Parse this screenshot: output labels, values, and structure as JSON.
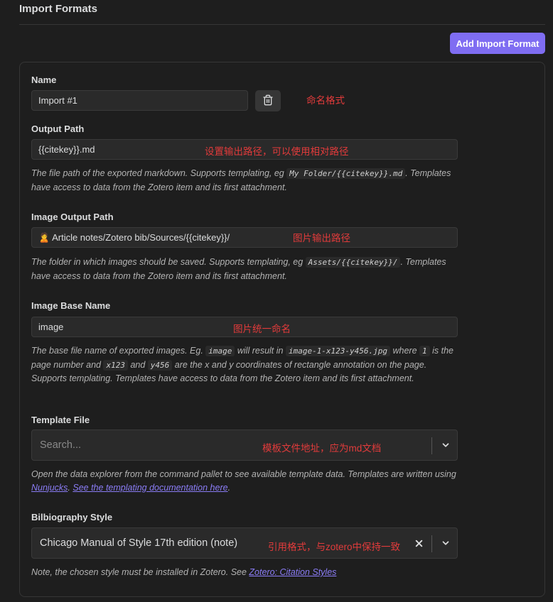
{
  "section": {
    "title": "Import Formats"
  },
  "actions": {
    "add_import_format": "Add Import Format"
  },
  "form": {
    "name": {
      "label": "Name",
      "value": "Import #1",
      "note": "命名格式"
    },
    "output_path": {
      "label": "Output Path",
      "value": "{{citekey}}.md",
      "note": "设置输出路径，可以使用相对路径",
      "desc_1": "The file path of the exported markdown. Supports templating, eg ",
      "desc_code": "My Folder/{{citekey}}.md",
      "desc_2": ". Templates have access to data from the Zotero item and its first attachment."
    },
    "image_output_path": {
      "label": "Image Output Path",
      "value": "🙎 Article notes/Zotero bib/Sources/{{citekey}}/",
      "note": "图片输出路径",
      "desc_1": "The folder in which images should be saved. Supports templating, eg ",
      "desc_code": "Assets/{{citekey}}/",
      "desc_2": ". Templates have access to data from the Zotero item and its first attachment."
    },
    "image_base_name": {
      "label": "Image Base Name",
      "value": "image",
      "note": "图片统一命名",
      "desc_1": "The base file name of exported images. Eg. ",
      "code_image": "image",
      "desc_2": " will result in ",
      "code_example": "image-1-x123-y456.jpg",
      "desc_3": " where ",
      "code_1": "1",
      "desc_4": " is the page number and ",
      "code_x": "x123",
      "desc_5": " and ",
      "code_y": "y456",
      "desc_6": " are the x and y coordinates of rectangle annotation on the page. Supports templating. Templates have access to data from the Zotero item and its first attachment."
    },
    "template_file": {
      "label": "Template File",
      "placeholder": "Search...",
      "note": "模板文件地址，应为md文档",
      "desc_1": "Open the data explorer from the command pallet to see available template data. Templates are written using ",
      "link_nunjucks": "Nunjucks",
      "desc_2": ". ",
      "link_docs": "See the templating documentation here",
      "desc_3": "."
    },
    "bibliography_style": {
      "label": "Bilbiography Style",
      "value": "Chicago Manual of Style 17th edition (note)",
      "note": "引用格式，与zotero中保持一致",
      "desc_1": "Note, the chosen style must be installed in Zotero. See ",
      "link_styles": "Zotero: Citation Styles"
    }
  },
  "icons": {
    "delete": "trash-icon",
    "dropdown": "chevron-down-icon",
    "clear": "close-icon"
  },
  "colors": {
    "accent": "#7f6df2",
    "background": "#1e1e1e",
    "annotation": "#e23b3b",
    "link": "#8a7cf5"
  }
}
